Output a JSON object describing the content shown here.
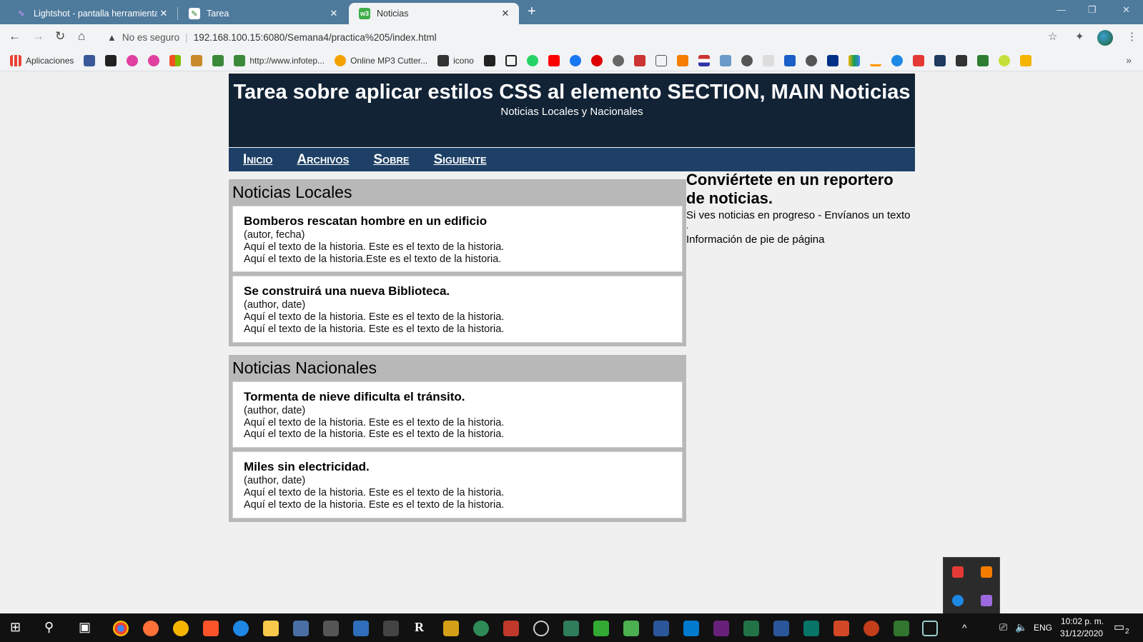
{
  "browser": {
    "tabs": [
      {
        "title": "Lightshot - pantalla herramienta",
        "close": "✕"
      },
      {
        "title": "Tarea",
        "close": "✕"
      },
      {
        "title": "Noticias",
        "close": "✕"
      }
    ],
    "new_tab": "+",
    "window_controls": {
      "minimize": "—",
      "restore": "❐",
      "close": "✕"
    },
    "nav": {
      "back": "←",
      "forward": "→",
      "reload": "↻",
      "home": "⌂"
    },
    "security_label": "No es seguro",
    "url": "192.168.100.15:6080/Semana4/practica%205/index.html",
    "bookmarks": [
      {
        "label": "Aplicaciones",
        "color": "#e94235"
      },
      {
        "label": "",
        "color": "#3b5998"
      },
      {
        "label": "",
        "color": "#222222"
      },
      {
        "label": "",
        "color": "#e040a0"
      },
      {
        "label": "",
        "color": "#e040a0"
      },
      {
        "label": "",
        "color": "#f4b400"
      },
      {
        "label": "",
        "color": "#c88a2a"
      },
      {
        "label": "",
        "color": "#3a8a3a"
      },
      {
        "label": "http://www.infotep...",
        "color": "#3a8a3a"
      },
      {
        "label": "Online MP3 Cutter...",
        "color": "#f4a000"
      },
      {
        "label": "icono",
        "color": "#333333"
      }
    ],
    "bookmarks_more": "»"
  },
  "page": {
    "header": {
      "title": "Tarea sobre aplicar estilos CSS al elemento SECTION, MAIN Noticias",
      "subtitle": "Noticias Locales y Nacionales"
    },
    "nav": [
      "Inicio",
      "Archivos",
      "Sobre",
      "Siguiente"
    ],
    "sections": [
      {
        "title": "Noticias Locales",
        "articles": [
          {
            "title": "Bomberos rescatan hombre en un edificio",
            "meta": "(autor, fecha)",
            "line1": "Aquí el texto de la historia. Este es el texto de la historia.",
            "line2": "Aquí el texto de la historia.Este es el texto de la historia."
          },
          {
            "title": "Se construirá una nueva Biblioteca.",
            "meta": "(author, date)",
            "line1": "Aquí el texto de la historia. Este es el texto de la historia.",
            "line2": "Aquí el texto de la historia. Este es el texto de la historia."
          }
        ]
      },
      {
        "title": "Noticias Nacionales",
        "articles": [
          {
            "title": "Tormenta de nieve dificulta el tránsito.",
            "meta": "(author, date)",
            "line1": "Aquí el texto de la historia. Este es el texto de la historia.",
            "line2": "Aquí el texto de la historia. Este es el texto de la historia."
          },
          {
            "title": "Miles sin electricidad.",
            "meta": "(author, date)",
            "line1": "Aquí el texto de la historia. Este es el texto de la historia.",
            "line2": "Aquí el texto de la historia. Este es el texto de la historia."
          }
        ]
      }
    ],
    "aside": {
      "title": "Conviértete en un reportero de noticias.",
      "text": "Si ves noticias en progreso - Envíanos un texto",
      "dot": ".",
      "footer": "Información de pie de página"
    }
  },
  "taskbar": {
    "language": "ENG",
    "time": "10:02 p. m.",
    "date": "31/12/2020",
    "notifications": "2"
  }
}
